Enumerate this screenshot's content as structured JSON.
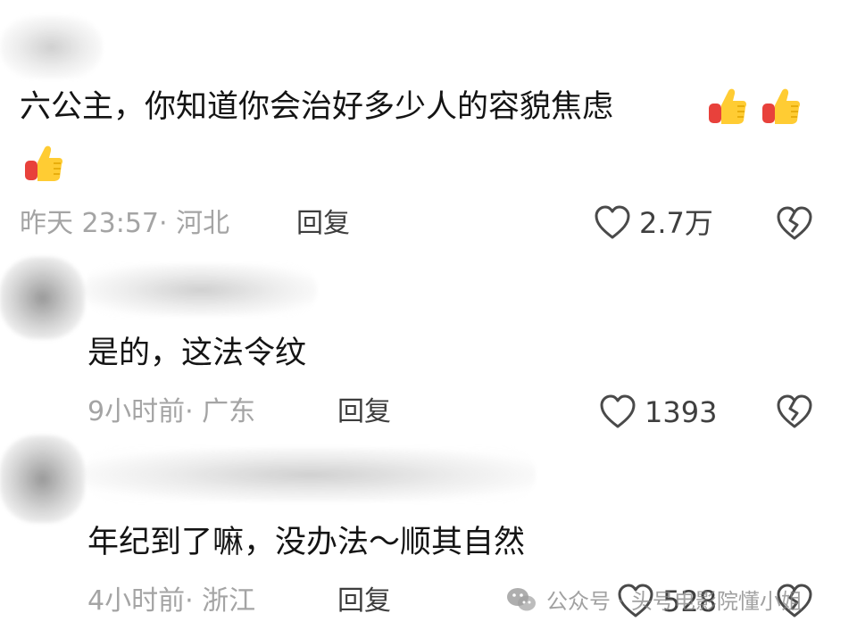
{
  "comments": [
    {
      "text": "六公主，你知道你会治好多少人的容貌焦虑",
      "emoji": [
        "thumbs-up-icon",
        "thumbs-up-icon",
        "thumbs-up-icon"
      ],
      "time": "昨天 23:57",
      "location": "· 河北",
      "reply_label": "回复",
      "likes": "2.7万"
    },
    {
      "text": "是的，这法令纹",
      "time": "9小时前",
      "location": "· 广东",
      "reply_label": "回复",
      "likes": "1393"
    },
    {
      "text": "年纪到了嘛，没办法～顺其自然",
      "time": "4小时前",
      "location": "· 浙江",
      "reply_label": "回复",
      "likes": "528"
    }
  ],
  "watermark": {
    "icon": "wechat-icon",
    "text": "公众号 · 头号电影院懂小姐"
  },
  "colors": {
    "meta": "#a4a4a4",
    "text": "#141414",
    "thumb_yellow": "#ffcc33",
    "thumb_red": "#e8413b"
  }
}
